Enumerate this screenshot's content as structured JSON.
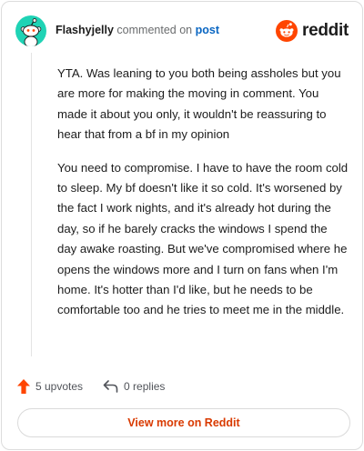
{
  "comment": {
    "author": "Flashyjelly",
    "action_text": "commented on",
    "post_link": "post",
    "brand": "reddit",
    "paragraphs": [
      "YTA. Was leaning to you both being assholes but you are more for making the moving in comment. You made it about you only, it wouldn't be reassuring to hear that from a bf in my opinion",
      "You need to compromise. I have to have the room cold to sleep. My bf doesn't like it so cold. It's worsened by the fact I work nights, and it's already hot during the day, so if he barely cracks the windows I spend the day awake roasting. But we've compromised where he opens the windows more and I turn on fans when I'm home. It's hotter than I'd like, but he needs to be comfortable too and he tries to meet me in the middle."
    ]
  },
  "actions": {
    "upvotes": "5 upvotes",
    "replies": "0 replies"
  },
  "view_more_label": "View more on Reddit",
  "icons": {
    "avatar": "snoo-avatar-icon",
    "logo": "reddit-logo-icon",
    "upvote": "upvote-arrow-icon",
    "reply": "reply-arrow-icon"
  },
  "colors": {
    "avatar_bg": "#1fd3b5",
    "upvote": "#ff4500",
    "link": "#0a66c2",
    "view_more_text": "#d93a00"
  }
}
